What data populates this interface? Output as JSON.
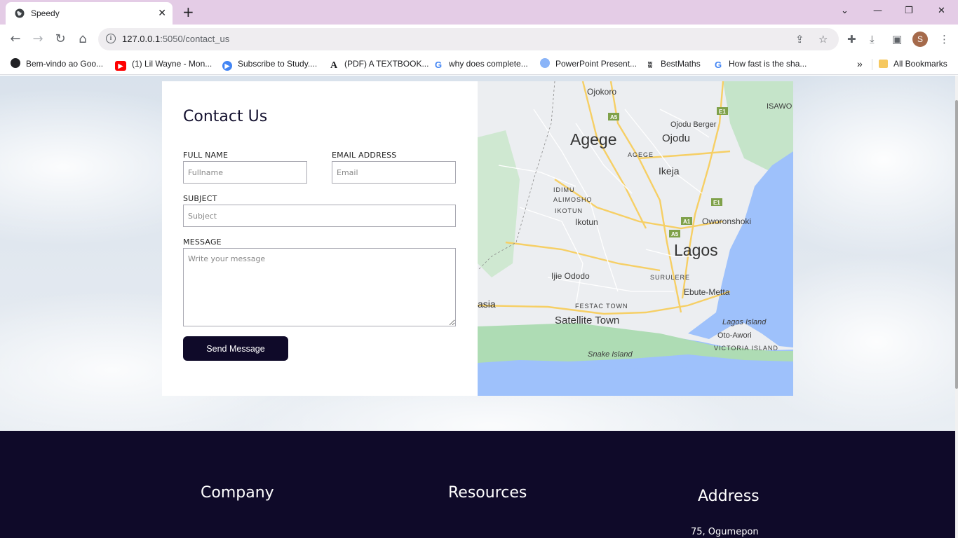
{
  "browser": {
    "tab_title": "Speedy",
    "url_host": "127.0.0.1",
    "url_path": ":5050/contact_us",
    "profile_initial": "S",
    "bookmarks": [
      {
        "label": "Bem-vindo ao Goo...",
        "icon": "globe-icon",
        "color": "#202124"
      },
      {
        "label": "(1) Lil Wayne - Mon...",
        "icon": "youtube-icon",
        "color": "#ff0000"
      },
      {
        "label": "Subscribe to Study....",
        "icon": "play-icon",
        "color": "#4285f4"
      },
      {
        "label": "(PDF) A TEXTBOOK...",
        "icon": "academia-icon",
        "color": "#202124"
      },
      {
        "label": "why does complete...",
        "icon": "google-icon",
        "color": "#4285f4"
      },
      {
        "label": "PowerPoint Present...",
        "icon": "cloud-icon",
        "color": "#8ab4f8"
      },
      {
        "label": "BestMaths",
        "icon": "butterfly-icon",
        "color": "#202124"
      },
      {
        "label": "How fast is the sha...",
        "icon": "google-icon",
        "color": "#4285f4"
      }
    ],
    "all_bookmarks_label": "All Bookmarks"
  },
  "contact": {
    "title": "Contact Us",
    "fullname_label": "FULL NAME",
    "fullname_placeholder": "Fullname",
    "email_label": "EMAIL ADDRESS",
    "email_placeholder": "Email",
    "subject_label": "SUBJECT",
    "subject_placeholder": "Subject",
    "message_label": "MESSAGE",
    "message_placeholder": "Write your message",
    "send_label": "Send Message"
  },
  "map": {
    "places": [
      "Ojokoro",
      "ISAWO",
      "Agege",
      "Ojodu Berger",
      "Ojodu",
      "AGEGE",
      "Ikeja",
      "IDIMU",
      "ALIMOSHO",
      "IKOTUN",
      "Ikotun",
      "Oworonshoki",
      "Lagos",
      "Ijie Ododo",
      "SURULERE",
      "Ebute-Metta",
      "asia",
      "FESTAC TOWN",
      "Satellite Town",
      "Lagos Island",
      "Oto-Awori",
      "VICTORIA ISLAND",
      "Snake Island"
    ],
    "road_shields": [
      "A5",
      "E1",
      "A1",
      "E1",
      "A5"
    ]
  },
  "footer": {
    "company_title": "Company",
    "resources_title": "Resources",
    "address_title": "Address",
    "address_line": "75, Ogumepon"
  },
  "colors": {
    "navy": "#0f0a29",
    "tab_strip": "#e4cce6",
    "water": "#9ec1fb",
    "park": "#bfe3c5",
    "road": "#f6cf65"
  }
}
